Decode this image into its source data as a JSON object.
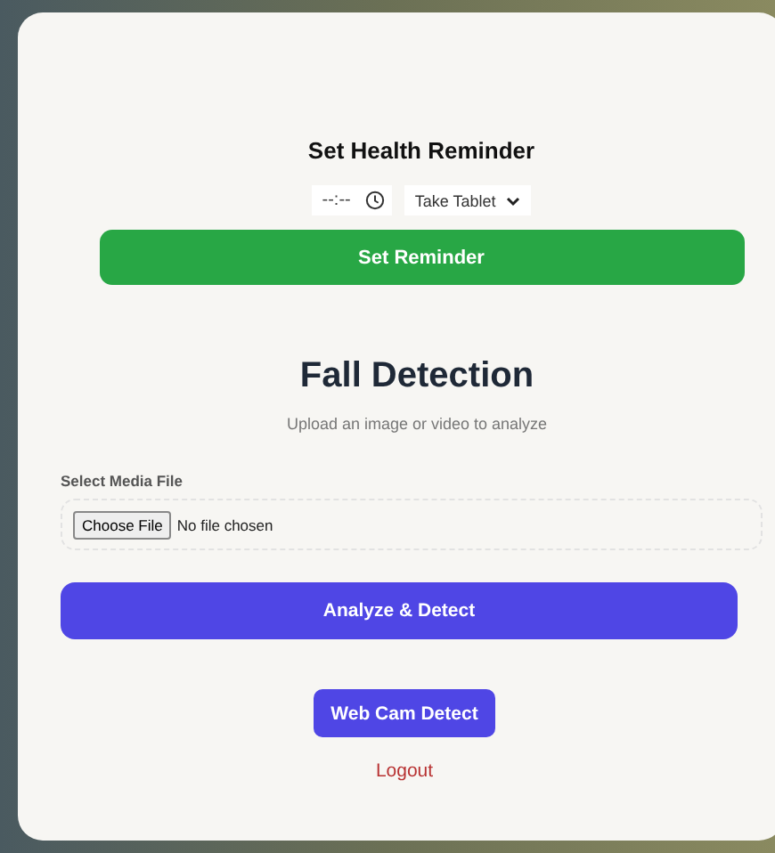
{
  "reminder": {
    "title": "Set Health Reminder",
    "time_field": {
      "placeholder": "--:--"
    },
    "type_select": {
      "value": "Take Tablet"
    },
    "button": "Set Reminder"
  },
  "fall_detection": {
    "title": "Fall Detection",
    "subtitle": "Upload an image or video to analyze",
    "file_label": "Select Media File",
    "file_button": "Choose File",
    "file_status": "No file chosen",
    "analyze_button": "Analyze & Detect",
    "webcam_button": "Web Cam Detect",
    "logout_link": "Logout"
  }
}
